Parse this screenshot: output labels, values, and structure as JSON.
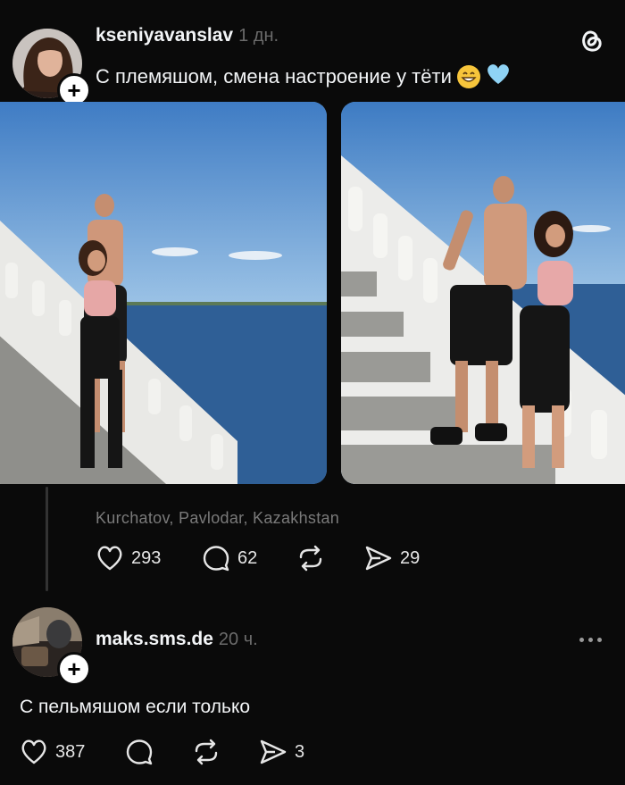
{
  "post": {
    "username": "kseniyavanslav",
    "time": "1 дн.",
    "text": "С племяшом, смена настроение у тёти",
    "emoji": [
      "grinning-face-emoji",
      "light-blue-heart-emoji"
    ],
    "location": "Kurchatov, Pavlodar, Kazakhstan",
    "likes": "293",
    "comments": "62",
    "shares": "29",
    "images": [
      "photo-1",
      "photo-2"
    ]
  },
  "reply": {
    "username": "maks.sms.de",
    "time": "20 ч.",
    "text": "С пельмяшом если только",
    "likes": "387",
    "shares": "3"
  },
  "app": {
    "logo": "threads-logo-icon"
  },
  "colors": {
    "background": "#0a0a0a",
    "text": "#f3f5f7",
    "muted": "#7a7a7a"
  }
}
